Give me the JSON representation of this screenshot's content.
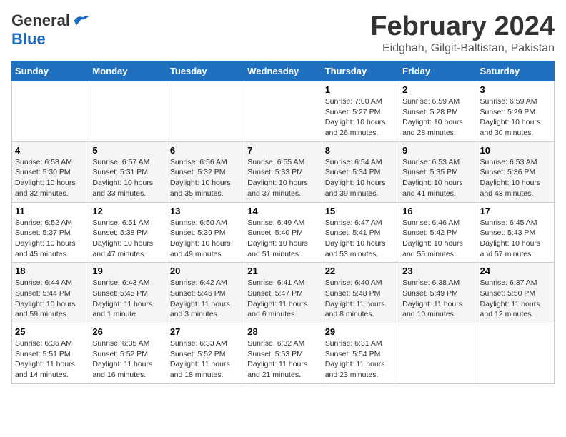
{
  "header": {
    "logo_general": "General",
    "logo_blue": "Blue",
    "month_year": "February 2024",
    "location": "Eidghah, Gilgit-Baltistan, Pakistan"
  },
  "weekdays": [
    "Sunday",
    "Monday",
    "Tuesday",
    "Wednesday",
    "Thursday",
    "Friday",
    "Saturday"
  ],
  "weeks": [
    [
      {
        "day": "",
        "info": ""
      },
      {
        "day": "",
        "info": ""
      },
      {
        "day": "",
        "info": ""
      },
      {
        "day": "",
        "info": ""
      },
      {
        "day": "1",
        "info": "Sunrise: 7:00 AM\nSunset: 5:27 PM\nDaylight: 10 hours\nand 26 minutes."
      },
      {
        "day": "2",
        "info": "Sunrise: 6:59 AM\nSunset: 5:28 PM\nDaylight: 10 hours\nand 28 minutes."
      },
      {
        "day": "3",
        "info": "Sunrise: 6:59 AM\nSunset: 5:29 PM\nDaylight: 10 hours\nand 30 minutes."
      }
    ],
    [
      {
        "day": "4",
        "info": "Sunrise: 6:58 AM\nSunset: 5:30 PM\nDaylight: 10 hours\nand 32 minutes."
      },
      {
        "day": "5",
        "info": "Sunrise: 6:57 AM\nSunset: 5:31 PM\nDaylight: 10 hours\nand 33 minutes."
      },
      {
        "day": "6",
        "info": "Sunrise: 6:56 AM\nSunset: 5:32 PM\nDaylight: 10 hours\nand 35 minutes."
      },
      {
        "day": "7",
        "info": "Sunrise: 6:55 AM\nSunset: 5:33 PM\nDaylight: 10 hours\nand 37 minutes."
      },
      {
        "day": "8",
        "info": "Sunrise: 6:54 AM\nSunset: 5:34 PM\nDaylight: 10 hours\nand 39 minutes."
      },
      {
        "day": "9",
        "info": "Sunrise: 6:53 AM\nSunset: 5:35 PM\nDaylight: 10 hours\nand 41 minutes."
      },
      {
        "day": "10",
        "info": "Sunrise: 6:53 AM\nSunset: 5:36 PM\nDaylight: 10 hours\nand 43 minutes."
      }
    ],
    [
      {
        "day": "11",
        "info": "Sunrise: 6:52 AM\nSunset: 5:37 PM\nDaylight: 10 hours\nand 45 minutes."
      },
      {
        "day": "12",
        "info": "Sunrise: 6:51 AM\nSunset: 5:38 PM\nDaylight: 10 hours\nand 47 minutes."
      },
      {
        "day": "13",
        "info": "Sunrise: 6:50 AM\nSunset: 5:39 PM\nDaylight: 10 hours\nand 49 minutes."
      },
      {
        "day": "14",
        "info": "Sunrise: 6:49 AM\nSunset: 5:40 PM\nDaylight: 10 hours\nand 51 minutes."
      },
      {
        "day": "15",
        "info": "Sunrise: 6:47 AM\nSunset: 5:41 PM\nDaylight: 10 hours\nand 53 minutes."
      },
      {
        "day": "16",
        "info": "Sunrise: 6:46 AM\nSunset: 5:42 PM\nDaylight: 10 hours\nand 55 minutes."
      },
      {
        "day": "17",
        "info": "Sunrise: 6:45 AM\nSunset: 5:43 PM\nDaylight: 10 hours\nand 57 minutes."
      }
    ],
    [
      {
        "day": "18",
        "info": "Sunrise: 6:44 AM\nSunset: 5:44 PM\nDaylight: 10 hours\nand 59 minutes."
      },
      {
        "day": "19",
        "info": "Sunrise: 6:43 AM\nSunset: 5:45 PM\nDaylight: 11 hours\nand 1 minute."
      },
      {
        "day": "20",
        "info": "Sunrise: 6:42 AM\nSunset: 5:46 PM\nDaylight: 11 hours\nand 3 minutes."
      },
      {
        "day": "21",
        "info": "Sunrise: 6:41 AM\nSunset: 5:47 PM\nDaylight: 11 hours\nand 6 minutes."
      },
      {
        "day": "22",
        "info": "Sunrise: 6:40 AM\nSunset: 5:48 PM\nDaylight: 11 hours\nand 8 minutes."
      },
      {
        "day": "23",
        "info": "Sunrise: 6:38 AM\nSunset: 5:49 PM\nDaylight: 11 hours\nand 10 minutes."
      },
      {
        "day": "24",
        "info": "Sunrise: 6:37 AM\nSunset: 5:50 PM\nDaylight: 11 hours\nand 12 minutes."
      }
    ],
    [
      {
        "day": "25",
        "info": "Sunrise: 6:36 AM\nSunset: 5:51 PM\nDaylight: 11 hours\nand 14 minutes."
      },
      {
        "day": "26",
        "info": "Sunrise: 6:35 AM\nSunset: 5:52 PM\nDaylight: 11 hours\nand 16 minutes."
      },
      {
        "day": "27",
        "info": "Sunrise: 6:33 AM\nSunset: 5:52 PM\nDaylight: 11 hours\nand 18 minutes."
      },
      {
        "day": "28",
        "info": "Sunrise: 6:32 AM\nSunset: 5:53 PM\nDaylight: 11 hours\nand 21 minutes."
      },
      {
        "day": "29",
        "info": "Sunrise: 6:31 AM\nSunset: 5:54 PM\nDaylight: 11 hours\nand 23 minutes."
      },
      {
        "day": "",
        "info": ""
      },
      {
        "day": "",
        "info": ""
      }
    ]
  ]
}
